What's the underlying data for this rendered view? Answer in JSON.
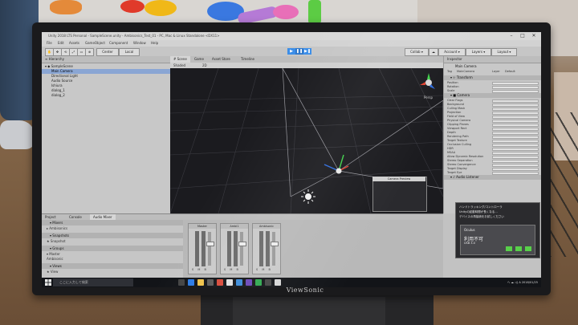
{
  "window": {
    "title": "Unity 2018 LTS Personal - SampleScene.unity - Ambisonics_Test_01 - PC, Mac & Linux Standalone <DX11>",
    "controls": [
      "–",
      "□",
      "✕"
    ]
  },
  "menu": [
    "File",
    "Edit",
    "Assets",
    "GameObject",
    "Component",
    "Window",
    "Help"
  ],
  "toolbar": {
    "tools": [
      "✋",
      "✥",
      "⟲",
      "⤢",
      "▭",
      "⊕"
    ],
    "pivot": "Center",
    "space": "Local",
    "play_controls": [
      "▶",
      "❚❚",
      "▶❚"
    ],
    "right_buttons": [
      "Collab ▾",
      "☁",
      "Account ▾",
      "Layers ▾",
      "Layout ▾"
    ]
  },
  "hierarchy": {
    "tab": "≡ Hierarchy",
    "items": [
      {
        "label": "▾ ◆ SampleScene",
        "indent": 0,
        "selected": false
      },
      {
        "label": "Main Camera",
        "indent": 1,
        "selected": true
      },
      {
        "label": "Directional Light",
        "indent": 1,
        "selected": false
      },
      {
        "label": "Audio Source",
        "indent": 1,
        "selected": false
      },
      {
        "label": "Ishiura",
        "indent": 1,
        "selected": false
      },
      {
        "label": "dialog_1",
        "indent": 1,
        "selected": false
      },
      {
        "label": "dialog_2",
        "indent": 1,
        "selected": false
      }
    ]
  },
  "scene": {
    "tabs": [
      "# Scene",
      "Game",
      "Asset Store",
      "Timeline"
    ],
    "active_tab": "# Scene",
    "shading": "Shaded",
    "mode": "2D",
    "persp": "Persp",
    "preview_title": "Camera Preview"
  },
  "inspector": {
    "tab": "Inspector",
    "object_name": "Main Camera",
    "tag_label": "Tag",
    "tag_value": "MainCamera",
    "layer_label": "Layer",
    "layer_value": "Default",
    "transform": {
      "header": "▾ ⊹ Transform",
      "rows": [
        "Position",
        "Rotation",
        "Scale"
      ]
    },
    "camera": {
      "header": "▾ ■ Camera",
      "rows": [
        "Clear Flags",
        "Background",
        "Culling Mask",
        "Projection",
        "Field of View",
        "Physical Camera",
        "Clipping Planes",
        "Viewport Rect",
        "Depth",
        "Rendering Path",
        "Target Texture",
        "Occlusion Culling",
        "HDR",
        "MSAA",
        "Allow Dynamic Resolution",
        "Stereo Separation",
        "Stereo Convergence",
        "Target Display",
        "Target Eye"
      ]
    },
    "audio_listener": "▾ ♪ Audio Listener",
    "add_component": "Add Component"
  },
  "popup": {
    "lines": [
      "ハンドトラッキング/コントローラ",
      "Unityの起動時間が長くなる…",
      "デバイスの再接続をお試しください"
    ],
    "card_title": "Oculus",
    "card_sub": "利用不可",
    "card_status": "USB 3.0"
  },
  "bottom": {
    "tabs": [
      "Project",
      "Console",
      "Audio Mixer"
    ],
    "active_tab": "Audio Mixer",
    "mixer_sections": [
      {
        "header": "▾ Mixers",
        "rows": [
          "▸ Ambisonics"
        ]
      },
      {
        "header": "▾ Snapshots",
        "rows": [
          "★ Snapshot"
        ]
      },
      {
        "header": "▾ Groups",
        "rows": [
          "▾ Master",
          "  Ambisonic"
        ]
      },
      {
        "header": "▾ Views",
        "rows": [
          "★ View"
        ]
      }
    ],
    "strips": [
      "Master",
      "Ambi1",
      "Ambisonic"
    ]
  },
  "taskbar": {
    "search_placeholder": "ここに入力して検索",
    "tray_text": "へ  ☁  ◁)  A  2018/01/25"
  },
  "monitor_brand": "ViewSonic",
  "colors": {
    "accent": "#3c8ee8",
    "selection": "#8aa6d4",
    "scene_bg": "#1b1b1f",
    "editor_gray": "#c2c2c2",
    "play_mode_tint": "#d6d6d6"
  }
}
